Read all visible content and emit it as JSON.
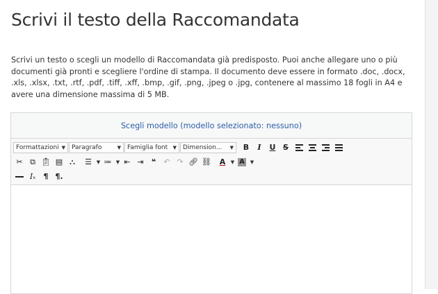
{
  "page": {
    "title": "Scrivi il testo della Raccomandata",
    "description": "Scrivi un testo o scegli un modello di Raccomandata già predisposto. Puoi anche allegare uno o più documenti già pronti e scegliere l'ordine di stampa. Il documento deve essere in formato .doc, .docx, .xls, .xlsx, .txt, .rtf, .pdf, .tiff, .xff, .bmp, .gif, .png, .jpeg o .jpg, contenere al massimo 18 fogli in A4 e avere una dimensione massima di 5 MB."
  },
  "editor": {
    "choose_model_label": "Scegli modello (modello selezionato: nessuno)",
    "combos": {
      "formats": "Formattazioni",
      "paragraph": "Paragrafo",
      "font_family": "Famiglia font",
      "font_size": "Dimension..."
    },
    "buttons": {
      "bold": "B",
      "italic": "I",
      "underline": "U",
      "strike": "S",
      "blockquote": "❝",
      "text_color": "A",
      "bg_color": "A"
    },
    "content": ""
  }
}
